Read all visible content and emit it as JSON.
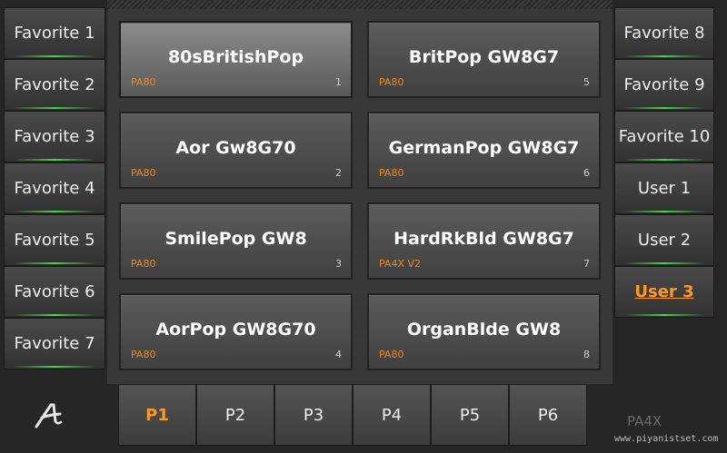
{
  "favorites_left": [
    "Favorite 1",
    "Favorite 2",
    "Favorite 3",
    "Favorite 4",
    "Favorite 5",
    "Favorite 6",
    "Favorite 7"
  ],
  "favorites_right": [
    {
      "label": "Favorite 8",
      "active": false
    },
    {
      "label": "Favorite 9",
      "active": false
    },
    {
      "label": "Favorite 10",
      "active": false
    },
    {
      "label": "User 1",
      "active": false
    },
    {
      "label": "User 2",
      "active": false
    },
    {
      "label": "User 3",
      "active": true
    }
  ],
  "styles": [
    {
      "name": "80sBritishPop",
      "tag": "PA80",
      "num": "1",
      "selected": true
    },
    {
      "name": "BritPop GW8G7",
      "tag": "PA80",
      "num": "5",
      "selected": false
    },
    {
      "name": "Aor Gw8G70",
      "tag": "PA80",
      "num": "2",
      "selected": false
    },
    {
      "name": "GermanPop GW8G7",
      "tag": "PA80",
      "num": "6",
      "selected": false
    },
    {
      "name": "SmilePop GW8",
      "tag": "PA80",
      "num": "3",
      "selected": false
    },
    {
      "name": "HardRkBld GW8G7",
      "tag": "PA4X V2",
      "num": "7",
      "selected": false
    },
    {
      "name": "AorPop GW8G70",
      "tag": "PA80",
      "num": "4",
      "selected": false
    },
    {
      "name": "OrganBlde GW8",
      "tag": "PA80",
      "num": "8",
      "selected": false
    }
  ],
  "pages": [
    {
      "label": "P1",
      "active": true
    },
    {
      "label": "P2",
      "active": false
    },
    {
      "label": "P3",
      "active": false
    },
    {
      "label": "P4",
      "active": false
    },
    {
      "label": "P5",
      "active": false
    },
    {
      "label": "P6",
      "active": false
    }
  ],
  "logo_icon": "korg-a-logo-icon",
  "model_label": "PA4X",
  "watermark": "www.piyanistset.com",
  "colors": {
    "accent": "#ff9a1f",
    "tag": "#f08a1a",
    "glow": "#4dd04d"
  }
}
